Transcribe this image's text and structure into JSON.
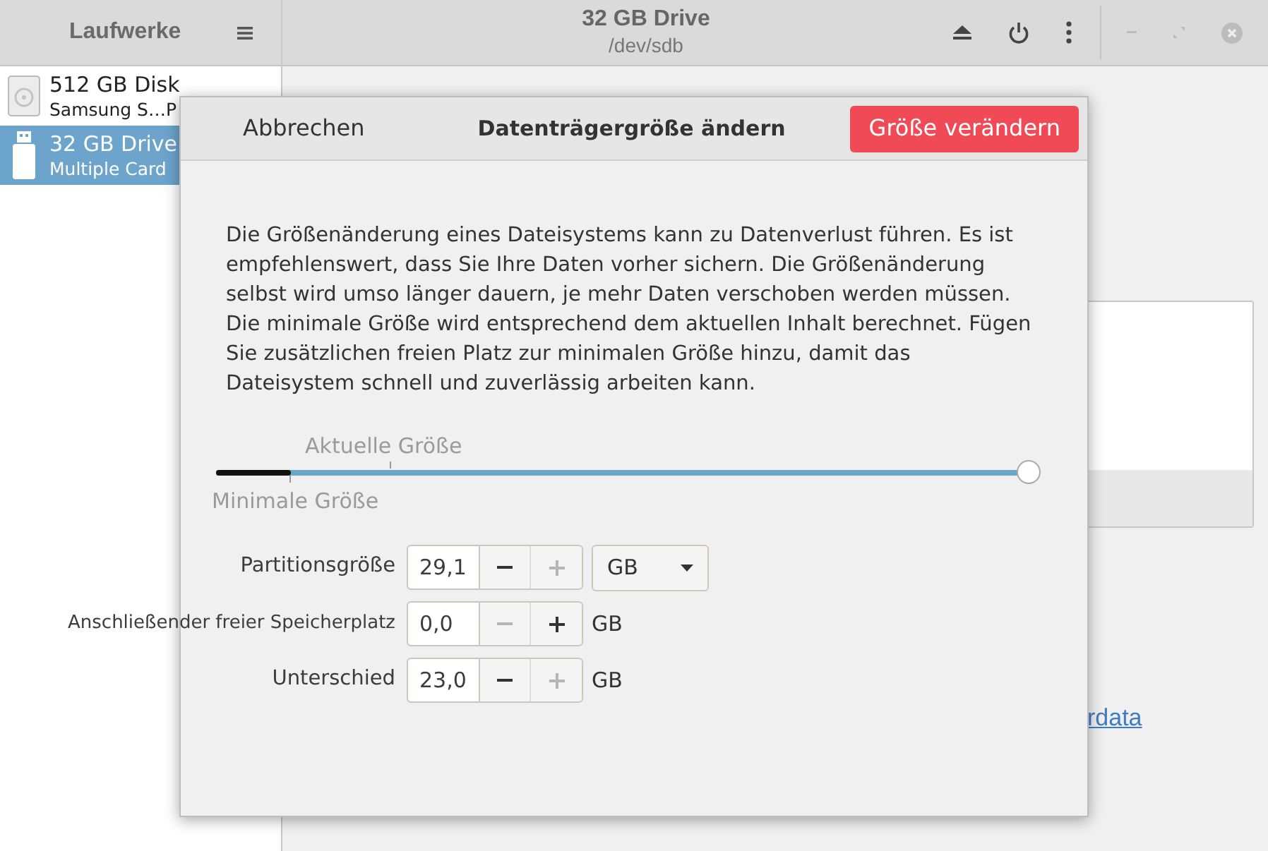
{
  "sidebar": {
    "title": "Laufwerke",
    "items": [
      {
        "kind": "disk",
        "name": "512 GB Disk",
        "detail": "Samsung S…P",
        "selected": false
      },
      {
        "kind": "usb",
        "name": "32 GB Drive",
        "detail": "Multiple Card",
        "selected": true
      }
    ]
  },
  "header": {
    "title": "32 GB Drive",
    "subtitle": "/dev/sdb"
  },
  "main": {
    "link": "rdata"
  },
  "dialog": {
    "cancel": "Abbrechen",
    "title": "Datenträgergröße ändern",
    "confirm": "Größe verändern",
    "message": "Die Größenänderung eines Dateisystems kann zu Datenverlust führen. Es ist empfehlenswert, dass Sie Ihre Daten vorher sichern. Die Größenänderung selbst wird umso länger dauern, je mehr Daten verschoben werden müssen. Die minimale Größe wird entsprechend dem aktuellen Inhalt berechnet. Fügen Sie zusätzlichen freien Platz zur minimalen Größe hinzu, damit das Dateisystem schnell und zuverlässig arbeiten kann.",
    "slider": {
      "current_label": "Aktuelle Größe",
      "minimum_label": "Minimale Größe",
      "level": 1
    },
    "fields": [
      {
        "kind": "dropdown",
        "label": "Partitionsgröße",
        "value": "29,1",
        "minus_disabled": false,
        "plus_disabled": true,
        "unit": "GB"
      },
      {
        "kind": "text",
        "label": "Anschließender freier Speicherplatz",
        "value": "0,0",
        "minus_disabled": true,
        "plus_disabled": false,
        "unit": "GB"
      },
      {
        "kind": "text",
        "label": "Unterschied",
        "value": "23,0",
        "minus_disabled": false,
        "plus_disabled": true,
        "unit": "GB"
      }
    ]
  }
}
